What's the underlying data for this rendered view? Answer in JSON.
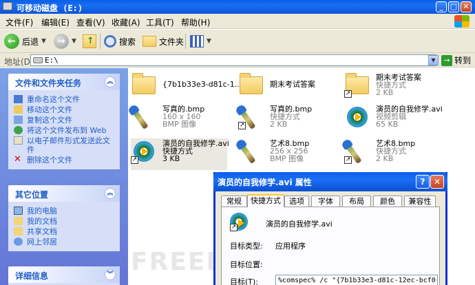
{
  "window": {
    "title": "可移动磁盘 (E:)",
    "controls": [
      "_",
      "□",
      "✕"
    ]
  },
  "menu": [
    "文件(F)",
    "编辑(E)",
    "查看(V)",
    "收藏(A)",
    "工具(T)",
    "帮助(H)"
  ],
  "toolbar": {
    "back_label": "后退",
    "search_label": "搜索",
    "folders_label": "文件夹"
  },
  "address": {
    "label": "地址(D)",
    "value": "E:\\",
    "go_label": "转到"
  },
  "tasks": {
    "file_tasks_title": "文件和文件夹任务",
    "file_tasks": [
      "重命名这个文件",
      "移动这个文件",
      "复制这个文件",
      "将这个文件发布到 Web",
      "以电子邮件形式发送此文件",
      "删除这个文件"
    ],
    "other_places_title": "其它位置",
    "other_places": [
      "我的电脑",
      "我的文档",
      "共享文档",
      "网上邻居"
    ],
    "details_title": "详细信息"
  },
  "files": [
    {
      "name": "{7b1b33e3-d81c-1...",
      "line2": "",
      "line3": "",
      "icon": "folder-icon"
    },
    {
      "name": "期末考试答案",
      "line2": "",
      "line3": "",
      "icon": "folder-icon"
    },
    {
      "name": "期末考试答案",
      "line2": "快捷方式",
      "line3": "2 KB",
      "icon": "folder-shortcut-icon"
    },
    {
      "name": "写真的.bmp",
      "line2": "160 x 160",
      "line3": "BMP 图像",
      "icon": "paint-brush-icon"
    },
    {
      "name": "写真的.bmp",
      "line2": "快捷方式",
      "line3": "2 KB",
      "icon": "paint-brush-shortcut-icon"
    },
    {
      "name": "演员的自我修学.avi",
      "line2": "视频剪辑",
      "line3": "65 KB",
      "icon": "media-player-icon"
    },
    {
      "name": "演员的自我修学.avi",
      "line2": "快捷方式",
      "line3": "3 KB",
      "icon": "media-player-shortcut-icon"
    },
    {
      "name": "艺术8.bmp",
      "line2": "256 x 256",
      "line3": "BMP 图像",
      "icon": "paint-brush-icon"
    },
    {
      "name": "艺术8.bmp",
      "line2": "快捷方式",
      "line3": "2 KB",
      "icon": "paint-brush-shortcut-icon"
    }
  ],
  "dialog": {
    "title": "演员的自我修学.avi 属性",
    "help": "?",
    "close": "✕",
    "tabs": [
      "常规",
      "快捷方式",
      "选项",
      "字体",
      "布局",
      "颜色",
      "兼容性"
    ],
    "active_tab": "快捷方式",
    "file_name": "演员的自我修学.avi",
    "target_type_label": "目标类型:",
    "target_type_value": "应用程序",
    "target_location_label": "目标位置:",
    "target_location_value": "",
    "target_label": "目标(T):",
    "target_value": "%comspec% /c \"{7b1b33e3-d81c-12ec-bcf0-"
  },
  "watermark": "FREEBUF",
  "colors": {
    "titlebar": "#0a5fe8",
    "task_pane": "#6375d6",
    "link": "#215dc6",
    "chrome": "#ece9d8"
  }
}
